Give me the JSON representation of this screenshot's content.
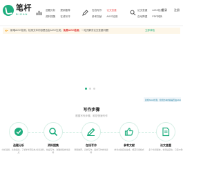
{
  "header": {
    "logo_name": "笔杆",
    "logo_sub": "BIGAN",
    "nav_groups": [
      [
        "选题分析",
        "提纲推荐",
        "资料搜集",
        "在线写作"
      ],
      [
        "论文查重",
        "AIGC检测",
        "自动降重",
        "PDF转换"
      ],
      [
        "在线写作",
        "论文查重",
        "参考文献",
        "AIGC检测"
      ]
    ],
    "login": "登录",
    "register": "注册"
  },
  "notice": {
    "text_before": "新增AIGC检测，检测文本内容是否由AIGC生成；",
    "highlight": "免费AIGC检测",
    "text_after": "，一站式解决论文查重问题！",
    "link": "立即体验"
  },
  "banner": {
    "active_slide": 1,
    "slide_count": 3
  },
  "tip": "新增AIGC检测，检测文本内容是否由AIGC生成",
  "steps": {
    "title": "写作步骤",
    "subtitle": "根据写作步骤，助您快速写作",
    "items": [
      {
        "title": "选题分析",
        "desc": "分析选题，比较选题，了解学术研究热点",
        "icon": "check-icon"
      },
      {
        "title": "资料搜集",
        "desc": "检索资料，快速写作，准确搜集参考资料",
        "icon": "search-icon"
      },
      {
        "title": "在线写作",
        "desc": "智能推荐，高效写作，提供写作参考资料",
        "icon": "pen-icon"
      },
      {
        "title": "参考文献",
        "desc": "参考文献自动生成，规范引用格式",
        "icon": "thumbs-up-icon"
      },
      {
        "title": "论文查重",
        "desc": "多个检测报告，检测速度快，只需30秒",
        "icon": "document-check-icon"
      }
    ]
  },
  "colors": {
    "brand": "#1fae7e",
    "notice_bg": "#fdf6e8",
    "highlight": "#d33"
  }
}
